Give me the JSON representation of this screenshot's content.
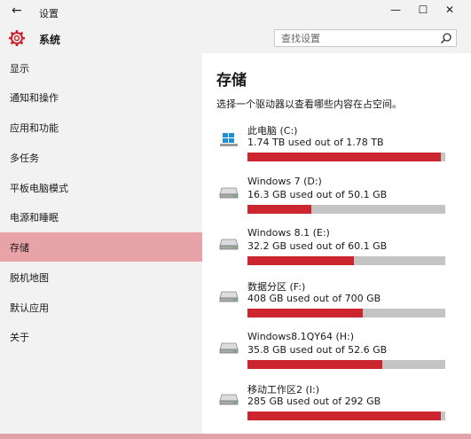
{
  "window": {
    "title": "设置",
    "controls": [
      "minimize-icon",
      "maximize-icon",
      "close-icon"
    ]
  },
  "header": {
    "section": "系统",
    "icon": "gear-icon",
    "search_placeholder": "查找设置"
  },
  "sidebar": {
    "items": [
      {
        "label": "显示"
      },
      {
        "label": "通知和操作"
      },
      {
        "label": "应用和功能"
      },
      {
        "label": "多任务"
      },
      {
        "label": "平板电脑模式"
      },
      {
        "label": "电源和睡眠"
      },
      {
        "label": "存储",
        "selected": true
      },
      {
        "label": "脱机地图"
      },
      {
        "label": "默认应用"
      },
      {
        "label": "关于"
      }
    ]
  },
  "main": {
    "heading": "存储",
    "description": "选择一个驱动器以查看哪些内容在占空间。",
    "drives": [
      {
        "name": "此电脑 (C:)",
        "usage": "1.74 TB used out of 1.78 TB",
        "used_fraction": 0.977,
        "icon": "windows-drive-icon"
      },
      {
        "name": "Windows 7 (D:)",
        "usage": "16.3 GB used out of 50.1 GB",
        "used_fraction": 0.325,
        "icon": "drive-icon"
      },
      {
        "name": "Windows 8.1 (E:)",
        "usage": "32.2 GB used out of 60.1 GB",
        "used_fraction": 0.536,
        "icon": "drive-icon"
      },
      {
        "name": "数据分区 (F:)",
        "usage": "408 GB used out of 700 GB",
        "used_fraction": 0.583,
        "icon": "drive-icon"
      },
      {
        "name": "Windows8.1QY64 (H:)",
        "usage": "35.8 GB used out of 52.6 GB",
        "used_fraction": 0.681,
        "icon": "drive-icon"
      },
      {
        "name": "移动工作区2 (I:)",
        "usage": "285 GB used out of 292 GB",
        "used_fraction": 0.976,
        "icon": "drive-icon"
      }
    ]
  },
  "colors": {
    "accent": "#cc2530",
    "bar_track": "#c4c4c4",
    "selected_bg": "#e8a3a8",
    "chrome_bg": "#f2f2f2"
  }
}
